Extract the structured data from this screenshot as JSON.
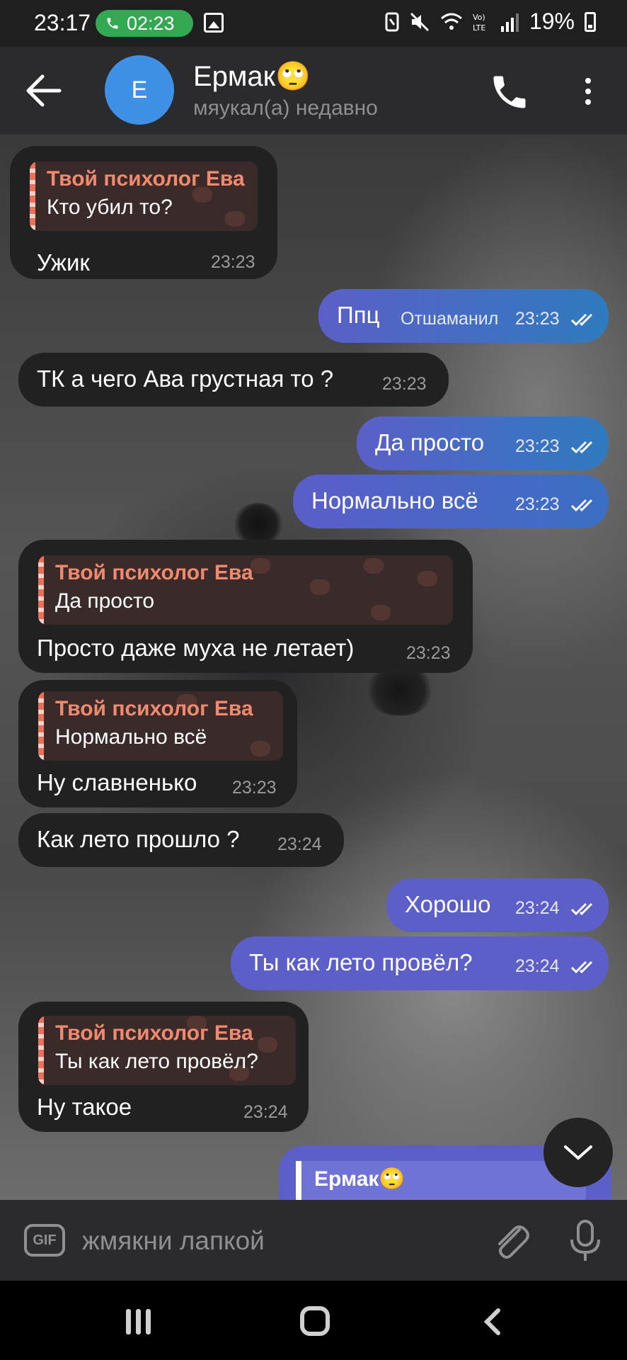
{
  "status_bar": {
    "time": "23:17",
    "call_timer": "02:23",
    "battery": "19%"
  },
  "header": {
    "name": "Ермак🙄",
    "avatar_letter": "E",
    "status": "мяукал(а) недавно"
  },
  "messages": [
    {
      "dir": "in",
      "reply_name": "Твой психолог Ева",
      "reply_text": "Кто убил то?",
      "text": "Ужик",
      "time": "23:23"
    },
    {
      "dir": "out",
      "text": "Ппц",
      "extra": "Отшаманил",
      "time": "23:23"
    },
    {
      "dir": "in",
      "text": "ТК а чего Ава грустная то ?",
      "time": "23:23"
    },
    {
      "dir": "out",
      "text": "Да просто",
      "time": "23:23"
    },
    {
      "dir": "out",
      "text": "Нормально всё",
      "time": "23:23"
    },
    {
      "dir": "in",
      "reply_name": "Твой психолог Ева",
      "reply_text": "Да просто",
      "text": "Просто даже муха не летает)",
      "time": "23:23"
    },
    {
      "dir": "in",
      "reply_name": "Твой психолог Ева",
      "reply_text": "Нормально всё",
      "text": "Ну славненько",
      "time": "23:23"
    },
    {
      "dir": "in",
      "text": "Как лето прошло ?",
      "time": "23:24"
    },
    {
      "dir": "out",
      "text": "Хорошо",
      "time": "23:24"
    },
    {
      "dir": "out",
      "text": "Ты как лето провёл?",
      "time": "23:24"
    },
    {
      "dir": "in",
      "reply_name": "Твой психолог Ева",
      "reply_text": "Ты как лето провёл?",
      "text": "Ну такое",
      "time": "23:24"
    }
  ],
  "partial_message": {
    "reply_name": "Ермак🙄"
  },
  "input": {
    "gif_label": "GIF",
    "placeholder": "жмякни лапкой"
  },
  "colors": {
    "header_bg": "#2b2b2d",
    "incoming_bubble": "#212121",
    "outgoing_bubble_start": "#5b5fc7",
    "outgoing_bubble_end": "#2f7bbf",
    "reply_name": "#f08a6e",
    "avatar": "#3f91e6",
    "call_pill": "#34a853"
  },
  "icons": [
    "call-pill-phone-icon",
    "gallery-icon",
    "mute-icon",
    "wifi-icon",
    "volte-icon",
    "signal-icon",
    "battery-icon",
    "back-arrow-icon",
    "phone-icon",
    "more-vertical-icon",
    "double-check-icon",
    "chevron-down-icon",
    "gif-icon",
    "paperclip-icon",
    "microphone-icon",
    "nav-recents-icon",
    "nav-home-icon",
    "nav-back-icon"
  ]
}
